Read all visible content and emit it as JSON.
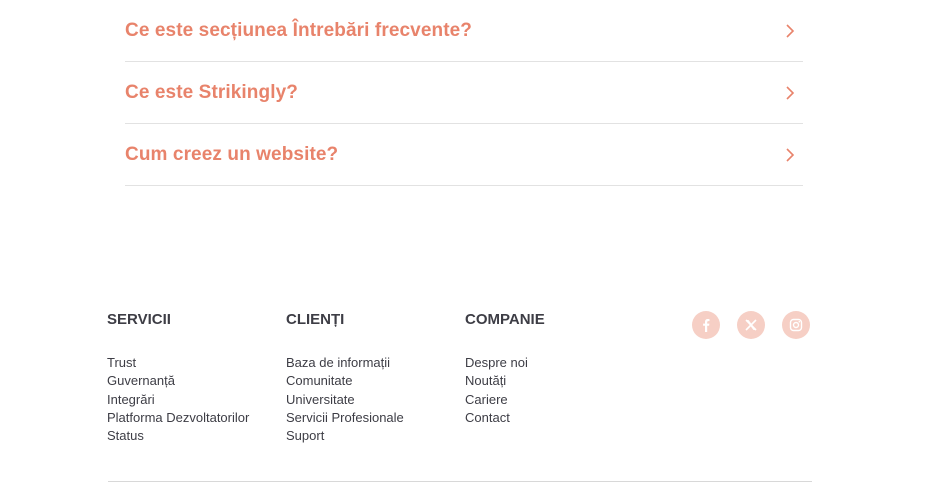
{
  "faq": {
    "items": [
      {
        "question": "Ce este secțiunea Întrebări frecvente?"
      },
      {
        "question": "Ce este Strikingly?"
      },
      {
        "question": "Cum creez un website?"
      }
    ]
  },
  "footer": {
    "columns": [
      {
        "title": "SERVICII",
        "links": [
          "Trust",
          "Guvernanță",
          "Integrări",
          "Platforma Dezvoltatorilor",
          "Status"
        ]
      },
      {
        "title": "CLIENȚI",
        "links": [
          "Baza de informații",
          "Comunitate",
          "Universitate",
          "Servicii Profesionale",
          "Suport"
        ]
      },
      {
        "title": "COMPANIE",
        "links": [
          "Despre noi",
          "Noutăți",
          "Cariere",
          "Contact"
        ]
      }
    ],
    "social": [
      {
        "icon": "facebook-icon"
      },
      {
        "icon": "x-twitter-icon"
      },
      {
        "icon": "instagram-icon"
      }
    ]
  },
  "colors": {
    "accent": "#e8836b",
    "social_bg": "#f6cfc5",
    "text_dark": "#3d3d45"
  }
}
